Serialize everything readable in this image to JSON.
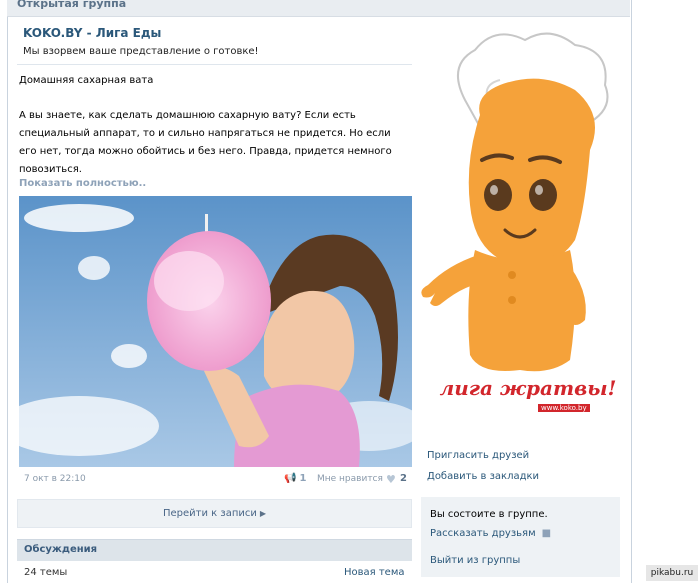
{
  "group": {
    "type_label": "Открытая группа"
  },
  "post": {
    "author": "KOKO.BY - Лига Еды",
    "status": "Мы взорвем ваше представление о готовке!",
    "subject": "Домашняя сахарная вата",
    "text": "А вы знаете, как сделать домашнюю сахарную вату? Если есть специальный аппарат, то и сильно напрягаться не придется. Но если его нет, тогда можно обойтись и без него. Правда, придется немного повозиться.",
    "show_more": "Показать полностью..",
    "date": "7 окт в 22:10",
    "shares": "1",
    "like_label": "Мне нравится",
    "likes": "2",
    "goto_label": "Перейти к записи"
  },
  "discussions": {
    "title": "Обсуждения",
    "count": "24 темы",
    "new_topic": "Новая тема"
  },
  "sidebar": {
    "logo_text": "лига жратвы!",
    "logo_url": "www.koko.by",
    "invite": "Пригласить друзей",
    "bookmark": "Добавить в закладки",
    "member_status": "Вы состоите в группе.",
    "tell_friends": "Рассказать друзьям",
    "leave": "Выйти из группы"
  },
  "watermark": "pikabu.ru",
  "colors": {
    "link": "#2b587a",
    "muted": "#8a9aab",
    "panel": "#eef2f5",
    "header": "#dde4ea",
    "brand_red": "#d2262c",
    "mascot_orange": "#f5a23a"
  }
}
